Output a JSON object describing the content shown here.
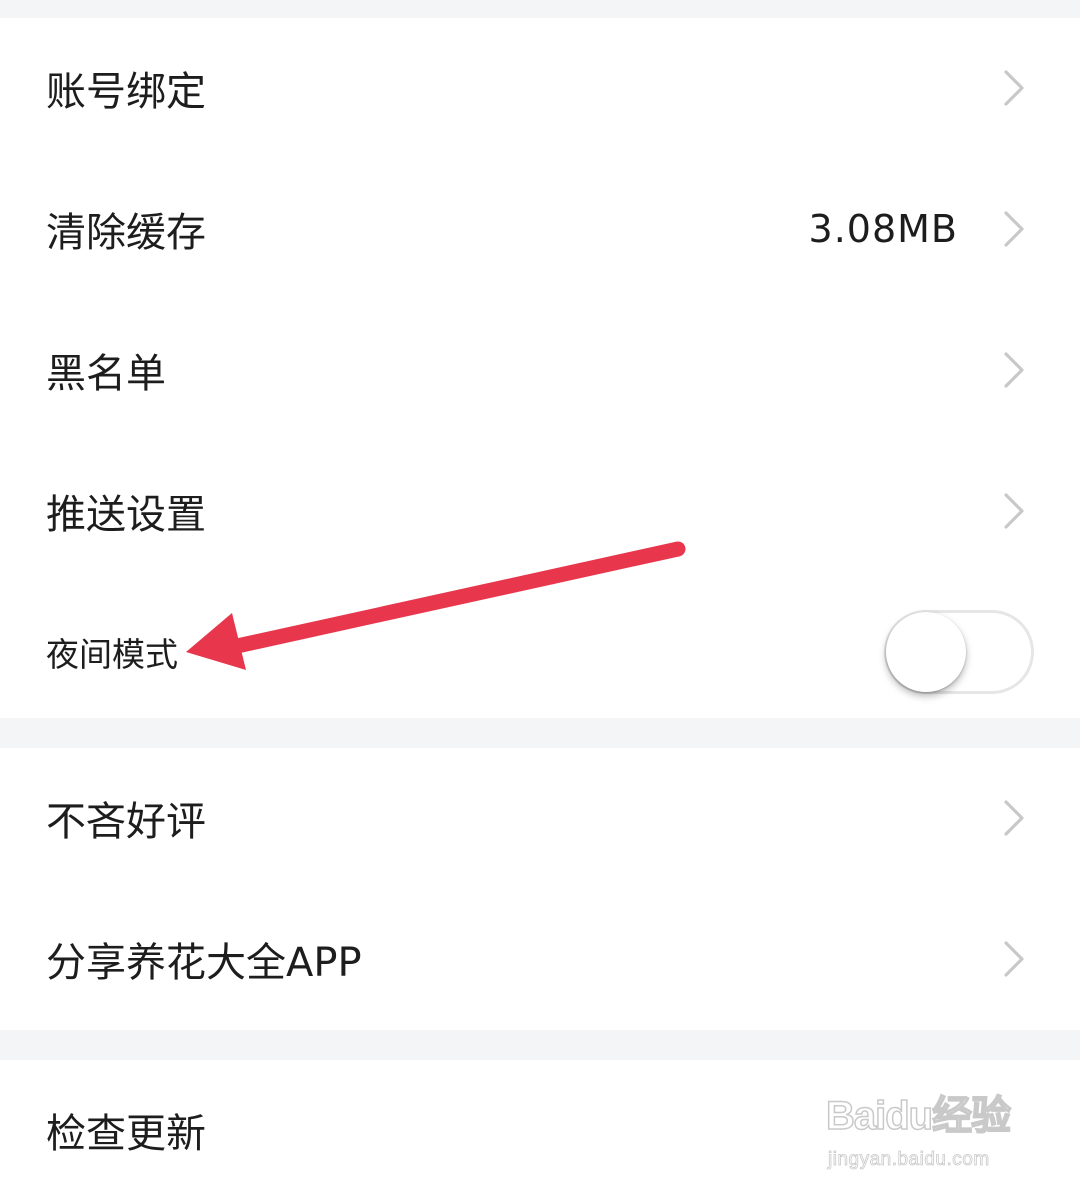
{
  "settings": {
    "group1": [
      {
        "label": "账号绑定",
        "value": ""
      },
      {
        "label": "清除缓存",
        "value": "3.08MB"
      },
      {
        "label": "黑名单",
        "value": ""
      },
      {
        "label": "推送设置",
        "value": ""
      }
    ],
    "night_mode": {
      "label": "夜间模式",
      "enabled": false
    },
    "group2": [
      {
        "label": "不吝好评"
      },
      {
        "label": "分享养花大全APP"
      }
    ],
    "group3": [
      {
        "label": "检查更新"
      }
    ]
  },
  "colors": {
    "background": "#f4f5f7",
    "card": "#ffffff",
    "text": "#1d1d1d",
    "chevron": "#c8c8c8",
    "annotation_arrow": "#e8374c",
    "toggle_track": "#ffffff",
    "toggle_border": "#e6e6e6"
  },
  "icons": {
    "chevron": "chevron-right-icon",
    "arrow": "red-arrow-annotation"
  },
  "watermark": {
    "brand": "Baidu经验",
    "site": "jingyan.baidu.com"
  }
}
